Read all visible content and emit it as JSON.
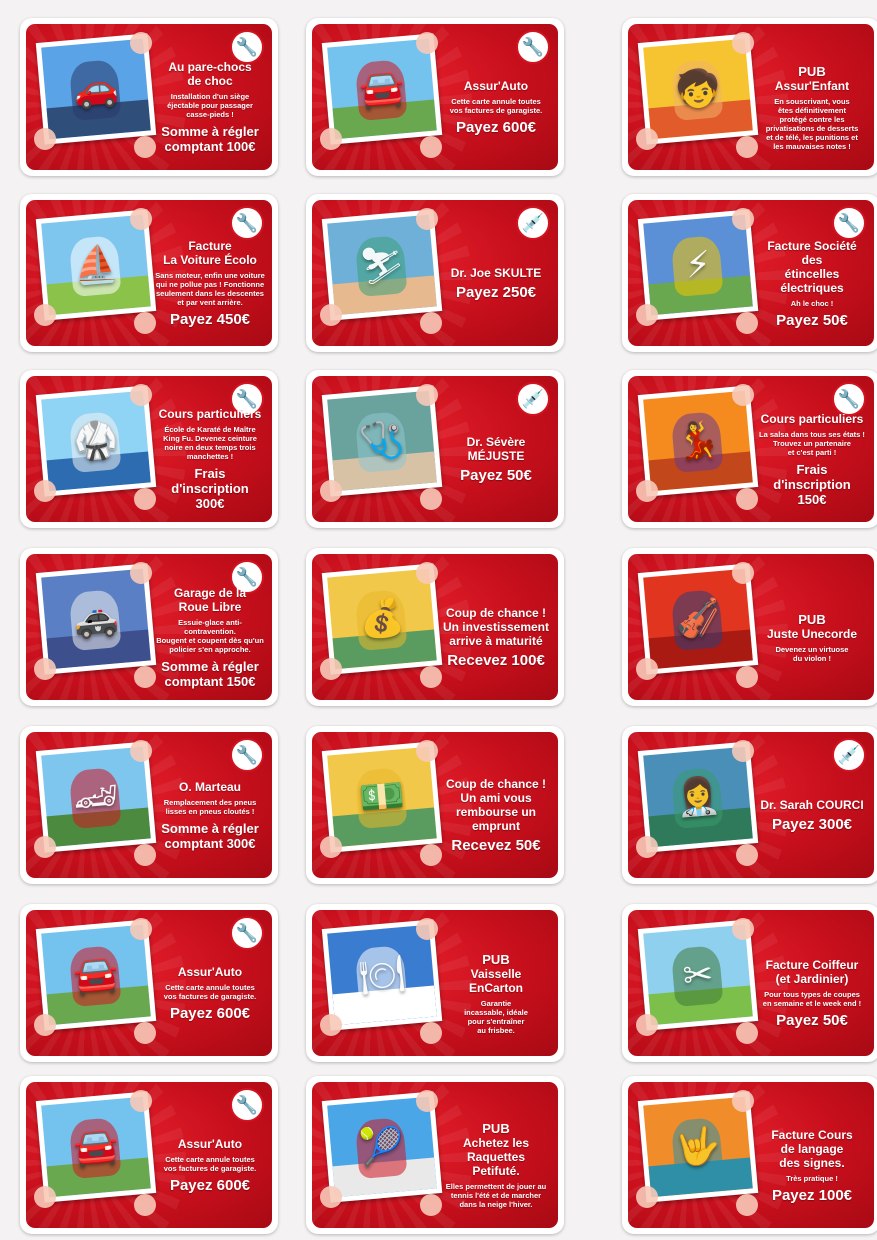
{
  "cards": [
    {
      "badge": "wrench-icon",
      "badge_glyph": "🔧",
      "pub": "",
      "title": "Au pare-chocs\nde choc",
      "desc": "Installation d'un siège\néjectable pour passager\ncasse-pieds !",
      "amount": "Somme à régler\ncomptant 100€",
      "amount_big": false,
      "scene_sky": "#5aa3e6",
      "scene_ground": "#2f4f7a",
      "figure": "#2a3a6a",
      "glyph": "🚗"
    },
    {
      "badge": "wrench-icon",
      "badge_glyph": "🔧",
      "pub": "",
      "title": "Assur'Auto",
      "desc": "Cette carte annule toutes\nvos factures de garagiste.",
      "amount": "Payez 600€",
      "amount_big": true,
      "scene_sky": "#74c3ee",
      "scene_ground": "#6aa84f",
      "figure": "#d11420",
      "glyph": "🚘"
    },
    {
      "badge": "",
      "badge_glyph": "",
      "pub": "PUB",
      "title": "Assur'Enfant",
      "desc": "En souscrivant, vous\nêtes définitivement\nprotégé contre les\nprivatisations de desserts\net de télé, les punitions et\nles mauvaises notes !",
      "amount": "",
      "amount_big": false,
      "scene_sky": "#f6c431",
      "scene_ground": "#e25b2b",
      "figure": "#f0b26a",
      "glyph": "🧒"
    },
    {
      "badge": "wrench-icon",
      "badge_glyph": "🔧",
      "pub": "",
      "title": "Facture\nLa Voiture Écolo",
      "desc": "Sans moteur, enfin une voiture\nqui ne pollue pas ! Fonctionne\nseulement dans les descentes\net par vent arrière.",
      "amount": "Payez 450€",
      "amount_big": true,
      "scene_sky": "#7fc6ef",
      "scene_ground": "#8bc34a",
      "figure": "#ffffff",
      "glyph": "⛵"
    },
    {
      "badge": "syringe-icon",
      "badge_glyph": "💉",
      "pub": "",
      "title": "Dr. Joe SKULTE",
      "desc": "",
      "amount": "Payez 250€",
      "amount_big": true,
      "scene_sky": "#6fb0d8",
      "scene_ground": "#e7b98f",
      "figure": "#3aa07a",
      "glyph": "⛷"
    },
    {
      "badge": "wrench-icon",
      "badge_glyph": "🔧",
      "pub": "",
      "title": "Facture Société des\nétincelles électriques",
      "desc": "Ah le choc !",
      "amount": "Payez 50€",
      "amount_big": true,
      "scene_sky": "#5b8fd6",
      "scene_ground": "#6aa84f",
      "figure": "#f4c400",
      "glyph": "⚡"
    },
    {
      "badge": "wrench-icon",
      "badge_glyph": "🔧",
      "pub": "",
      "title": "Cours particuliers",
      "desc": "École de Karaté de Maître\nKing Fu. Devenez ceinture\nnoire en deux temps trois\nmanchettes !",
      "amount": "Frais d'inscription\n300€",
      "amount_big": false,
      "scene_sky": "#8fd3f5",
      "scene_ground": "#2d6cb0",
      "figure": "#f2f2f2",
      "glyph": "🥋"
    },
    {
      "badge": "syringe-icon",
      "badge_glyph": "💉",
      "pub": "",
      "title": "Dr. Sévère\nMÉJUSTE",
      "desc": "",
      "amount": "Payez 50€",
      "amount_big": true,
      "scene_sky": "#6aa39d",
      "scene_ground": "#d7c2a6",
      "figure": "#8fc6d0",
      "glyph": "🩺"
    },
    {
      "badge": "wrench-icon",
      "badge_glyph": "🔧",
      "pub": "",
      "title": "Cours particuliers",
      "desc": "La salsa dans tous ses états !\nTrouvez un partenaire\net c'est parti !",
      "amount": "Frais d'inscription\n150€",
      "amount_big": false,
      "scene_sky": "#f58a1f",
      "scene_ground": "#c2471b",
      "figure": "#6a3a8c",
      "glyph": "💃"
    },
    {
      "badge": "wrench-icon",
      "badge_glyph": "🔧",
      "pub": "",
      "title": "Garage de la\nRoue Libre",
      "desc": "Essuie-glace anti-contravention.\nBougent et coupent dès qu'un\npolicier s'en approche.",
      "amount": "Somme à régler\ncomptant 150€",
      "amount_big": false,
      "scene_sky": "#5a7fc4",
      "scene_ground": "#3d4f8c",
      "figure": "#f0f0f0",
      "glyph": "🚓"
    },
    {
      "badge": "",
      "badge_glyph": "",
      "pub": "",
      "title": "Coup de chance !\nUn investissement\narrive à maturité",
      "desc": "",
      "amount": "Recevez 100€",
      "amount_big": true,
      "scene_sky": "#f1c84a",
      "scene_ground": "#5a9c5f",
      "figure": "#e9b62a",
      "glyph": "💰"
    },
    {
      "badge": "",
      "badge_glyph": "",
      "pub": "PUB",
      "title": "Juste Unecorde",
      "desc": "Devenez un virtuose\ndu violon !",
      "amount": "",
      "amount_big": false,
      "scene_sky": "#e2351f",
      "scene_ground": "#a81a12",
      "figure": "#2a3f7a",
      "glyph": "🎻"
    },
    {
      "badge": "wrench-icon",
      "badge_glyph": "🔧",
      "pub": "",
      "title": "O. Marteau",
      "desc": "Remplacement des pneus\nlisses en pneus cloutés !",
      "amount": "Somme à régler\ncomptant 300€",
      "amount_big": false,
      "scene_sky": "#7fc6ef",
      "scene_ground": "#4c8a3f",
      "figure": "#d11420",
      "glyph": "🏎"
    },
    {
      "badge": "",
      "badge_glyph": "",
      "pub": "",
      "title": "Coup de chance !\nUn ami vous\nrembourse un\nemprunt",
      "desc": "",
      "amount": "Recevez 50€",
      "amount_big": true,
      "scene_sky": "#f1c84a",
      "scene_ground": "#5a9c5f",
      "figure": "#e9b62a",
      "glyph": "💵"
    },
    {
      "badge": "syringe-icon",
      "badge_glyph": "💉",
      "pub": "",
      "title": "Dr. Sarah COURCI",
      "desc": "",
      "amount": "Payez 300€",
      "amount_big": true,
      "scene_sky": "#4a8fb8",
      "scene_ground": "#2e7a5a",
      "figure": "#3a9a70",
      "glyph": "👩‍⚕️"
    },
    {
      "badge": "wrench-icon",
      "badge_glyph": "🔧",
      "pub": "",
      "title": "Assur'Auto",
      "desc": "Cette carte annule toutes\nvos factures de garagiste.",
      "amount": "Payez 600€",
      "amount_big": true,
      "scene_sky": "#74c3ee",
      "scene_ground": "#6aa84f",
      "figure": "#d11420",
      "glyph": "🚘"
    },
    {
      "badge": "",
      "badge_glyph": "",
      "pub": "PUB",
      "title": "Vaisselle\nEnCarton",
      "desc": "Garantie\nincassable, idéale\npour s'entraîner\nau frisbee.",
      "amount": "",
      "amount_big": false,
      "scene_sky": "#3a7cd0",
      "scene_ground": "#ffffff",
      "figure": "#ffffff",
      "glyph": "🍽"
    },
    {
      "badge": "",
      "badge_glyph": "",
      "pub": "",
      "title": "Facture Coiffeur\n(et Jardinier)",
      "desc": "Pour tous types de coupes\nen semaine et le week end !",
      "amount": "Payez 50€",
      "amount_big": true,
      "scene_sky": "#8fd0ef",
      "scene_ground": "#7cbf4a",
      "figure": "#3f7a3a",
      "glyph": "✂"
    },
    {
      "badge": "wrench-icon",
      "badge_glyph": "🔧",
      "pub": "",
      "title": "Assur'Auto",
      "desc": "Cette carte annule toutes\nvos factures de garagiste.",
      "amount": "Payez 600€",
      "amount_big": true,
      "scene_sky": "#74c3ee",
      "scene_ground": "#6aa84f",
      "figure": "#d11420",
      "glyph": "🚘"
    },
    {
      "badge": "",
      "badge_glyph": "",
      "pub": "PUB",
      "title": "Achetez les\nRaquettes\nPetifuté.",
      "desc": "Elles permettent de jouer au\ntennis l'été et de marcher\ndans la neige l'hiver.",
      "amount": "",
      "amount_big": false,
      "scene_sky": "#4aa6e6",
      "scene_ground": "#e9e9e9",
      "figure": "#d11420",
      "glyph": "🎾"
    },
    {
      "badge": "",
      "badge_glyph": "",
      "pub": "",
      "title": "Facture Cours\nde langage\ndes signes.",
      "desc": "Très pratique !",
      "amount": "Payez 100€",
      "amount_big": true,
      "scene_sky": "#f08c2a",
      "scene_ground": "#2f8fa6",
      "figure": "#2f8fa6",
      "glyph": "🤟"
    }
  ]
}
